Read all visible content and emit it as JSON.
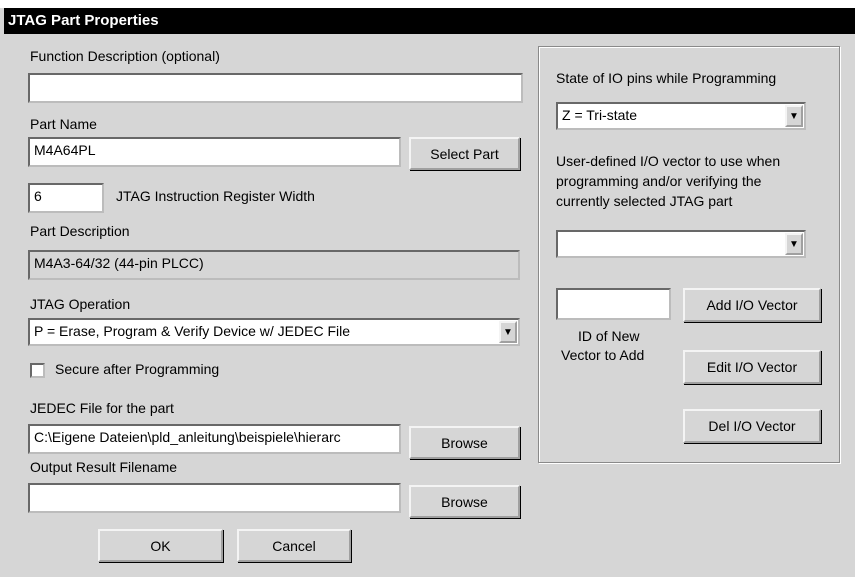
{
  "window": {
    "title": "JTAG Part Properties"
  },
  "function_description": {
    "label": "Function Description (optional)",
    "value": ""
  },
  "part_name": {
    "label": "Part Name",
    "value": "M4A64PL",
    "select_button": "Select Part"
  },
  "ir_width": {
    "value": "6",
    "label": "JTAG Instruction Register Width"
  },
  "part_description": {
    "label": "Part Description",
    "value": "M4A3-64/32 (44-pin PLCC)"
  },
  "jtag_operation": {
    "label": "JTAG Operation",
    "selected": "P = Erase, Program & Verify Device w/ JEDEC File"
  },
  "secure": {
    "label": "Secure after Programming",
    "checked": false
  },
  "jedec_file": {
    "label": "JEDEC File for the part",
    "value": "C:\\Eigene Dateien\\pld_anleitung\\beispiele\\hierarc",
    "browse_button": "Browse"
  },
  "output_file": {
    "label": "Output Result Filename",
    "value": "",
    "browse_button": "Browse"
  },
  "io_state": {
    "label": "State of IO pins while Programming",
    "selected": "Z = Tri-state"
  },
  "io_vector": {
    "label_line1": "User-defined I/O vector to use when",
    "label_line2": "programming and/or verifying the",
    "label_line3": "currently selected JTAG part",
    "selected": ""
  },
  "new_vector": {
    "value": "",
    "id_label_line1": "ID of New",
    "id_label_line2": "Vector to Add",
    "add_button": "Add I/O Vector",
    "edit_button": "Edit I/O Vector",
    "del_button": "Del I/O Vector"
  },
  "footer": {
    "ok_button": "OK",
    "cancel_button": "Cancel"
  },
  "icons": {
    "dropdown": "dropdown-arrow-icon"
  }
}
